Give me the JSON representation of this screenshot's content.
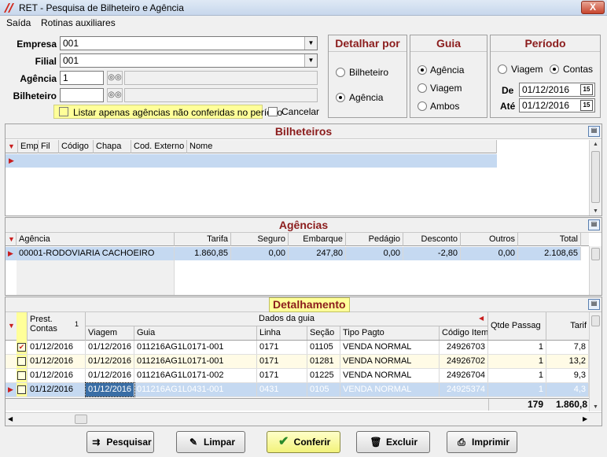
{
  "window": {
    "title": "RET - Pesquisa de Bilheteiro e Agência",
    "close": "X"
  },
  "menu": [
    "Saída",
    "Rotinas auxiliares"
  ],
  "form": {
    "empresa_label": "Empresa",
    "empresa_value": "001",
    "filial_label": "Filial",
    "filial_value": "001",
    "agencia_label": "Agência",
    "agencia_value": "1",
    "bilheteiro_label": "Bilheteiro",
    "bilheteiro_value": "",
    "listar_label": "Listar apenas agências não conferidas no período",
    "cancelar_label": "Cancelar"
  },
  "detalhar": {
    "title": "Detalhar por",
    "opt1": "Bilheteiro",
    "opt2": "Agência",
    "selected": "Agência"
  },
  "guia": {
    "title": "Guia",
    "opt1": "Agência",
    "opt2": "Viagem",
    "opt3": "Ambos",
    "selected": "Agência"
  },
  "periodo": {
    "title": "Período",
    "opt1": "Viagem",
    "opt2": "Contas",
    "selected": "Contas",
    "de_label": "De",
    "de_value": "01/12/2016",
    "ate_label": "Até",
    "ate_value": "01/12/2016"
  },
  "bilheteiros": {
    "title": "Bilheteiros",
    "columns": [
      "Emp",
      "Fil",
      "Código",
      "Chapa",
      "Cod. Externo",
      "Nome"
    ]
  },
  "agencias": {
    "title": "Agências",
    "columns": [
      "Agência",
      "Tarifa",
      "Seguro",
      "Embarque",
      "Pedágio",
      "Desconto",
      "Outros",
      "Total"
    ],
    "row": [
      "00001-RODOVIARIA CACHOEIRO",
      "1.860,85",
      "0,00",
      "247,80",
      "0,00",
      "-2,80",
      "0,00",
      "2.108,65"
    ]
  },
  "detalhamento": {
    "title": "Detalhamento",
    "prest_label_1": "Prest.",
    "prest_label_2": "Contas",
    "sort_indicator": "1",
    "group_header": "Dados da guia",
    "columns": [
      "Viagem",
      "Guia",
      "Linha",
      "Seção",
      "Tipo Pagto",
      "Código Item",
      "Qtde Passag",
      "Tarif"
    ],
    "rows": [
      {
        "checked": true,
        "prest": "01/12/2016",
        "viagem": "01/12/2016",
        "guia": "011216AG1L0171-001",
        "linha": "0171",
        "secao": "01105",
        "tipo": "VENDA NORMAL",
        "codigo": "24926703",
        "qtde": "1",
        "tarifa": "7,8"
      },
      {
        "checked": false,
        "prest": "01/12/2016",
        "viagem": "01/12/2016",
        "guia": "011216AG1L0171-001",
        "linha": "0171",
        "secao": "01281",
        "tipo": "VENDA NORMAL",
        "codigo": "24926702",
        "qtde": "1",
        "tarifa": "13,2"
      },
      {
        "checked": false,
        "prest": "01/12/2016",
        "viagem": "01/12/2016",
        "guia": "011216AG1L0171-002",
        "linha": "0171",
        "secao": "01225",
        "tipo": "VENDA NORMAL",
        "codigo": "24926704",
        "qtde": "1",
        "tarifa": "9,3"
      },
      {
        "checked": false,
        "prest": "01/12/2016",
        "viagem": "01/12/2016",
        "guia": "011216AG1L0431-001",
        "linha": "0431",
        "secao": "0105",
        "tipo": "VENDA NORMAL",
        "codigo": "24925374",
        "qtde": "1",
        "tarifa": "4,3"
      }
    ],
    "total_qtde": "179",
    "total_tarifa": "1.860,8"
  },
  "buttons": {
    "pesquisar": "Pesquisar",
    "limpar": "Limpar",
    "conferir": "Conferir",
    "excluir": "Excluir",
    "imprimir": "Imprimir"
  },
  "colors": {
    "header_red": "#8b1c1c",
    "highlight_yellow": "#ffff99",
    "selected_row": "#c5d9f1"
  }
}
